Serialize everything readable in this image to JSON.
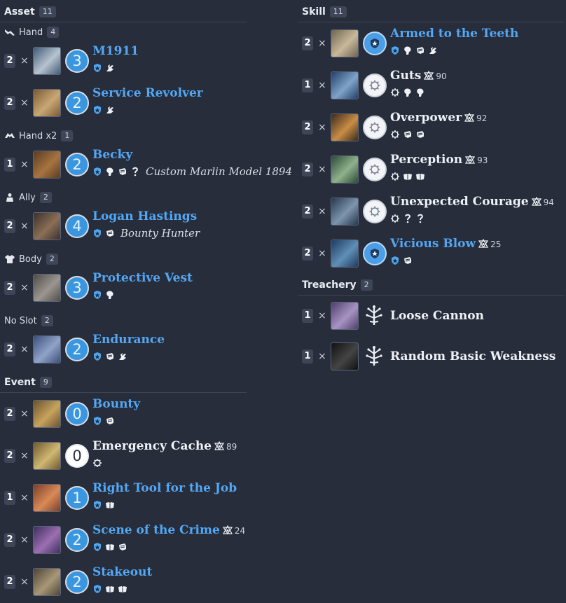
{
  "sections": {
    "asset": {
      "title": "Asset",
      "count": "11"
    },
    "event": {
      "title": "Event",
      "count": "9"
    },
    "skill": {
      "title": "Skill",
      "count": "11"
    },
    "treachery": {
      "title": "Treachery",
      "count": "2"
    }
  },
  "slots": {
    "hand": {
      "label": "Hand",
      "count": "4"
    },
    "hand2": {
      "label": "Hand x2",
      "count": "1"
    },
    "ally": {
      "label": "Ally",
      "count": "2"
    },
    "body": {
      "label": "Body",
      "count": "2"
    },
    "noslot": {
      "label": "No Slot",
      "count": "2"
    }
  },
  "times_symbol": "×",
  "assets": [
    {
      "qty": "2",
      "cost": "3",
      "name": "M1911",
      "icons": [
        "guardian-icon",
        "agility-icon"
      ]
    },
    {
      "qty": "2",
      "cost": "2",
      "name": "Service Revolver",
      "icons": [
        "guardian-icon",
        "agility-icon"
      ]
    },
    {
      "qty": "1",
      "cost": "2",
      "name": "Becky",
      "subname": "Custom Marlin Model 1894",
      "icons": [
        "guardian-icon",
        "willpower-icon",
        "combat-icon",
        "wild-icon"
      ]
    },
    {
      "qty": "2",
      "cost": "4",
      "name": "Logan Hastings",
      "subname": "Bounty Hunter",
      "icons": [
        "guardian-icon",
        "combat-icon"
      ]
    },
    {
      "qty": "2",
      "cost": "3",
      "name": "Protective Vest",
      "icons": [
        "guardian-icon",
        "willpower-icon"
      ]
    },
    {
      "qty": "2",
      "cost": "2",
      "name": "Endurance",
      "icons": [
        "guardian-icon",
        "combat-icon",
        "agility-icon"
      ]
    }
  ],
  "events": [
    {
      "qty": "2",
      "cost": "0",
      "name": "Bounty",
      "icons": [
        "guardian-icon",
        "combat-icon"
      ]
    },
    {
      "qty": "2",
      "cost": "0",
      "name": "Emergency Cache",
      "xp": "89",
      "neutral": true,
      "icons": [
        "neutral-icon"
      ]
    },
    {
      "qty": "1",
      "cost": "1",
      "name": "Right Tool for the Job",
      "icons": [
        "guardian-icon",
        "intellect-icon"
      ]
    },
    {
      "qty": "2",
      "cost": "2",
      "name": "Scene of the Crime",
      "xp": "24",
      "icons": [
        "guardian-icon",
        "intellect-icon",
        "combat-icon"
      ]
    },
    {
      "qty": "2",
      "cost": "2",
      "name": "Stakeout",
      "icons": [
        "guardian-icon",
        "intellect-icon",
        "intellect-icon"
      ]
    }
  ],
  "skills": [
    {
      "qty": "2",
      "name": "Armed to the Teeth",
      "guardian": true,
      "icons": [
        "guardian-icon",
        "willpower-icon",
        "combat-icon",
        "agility-icon"
      ]
    },
    {
      "qty": "1",
      "name": "Guts",
      "xp": "90",
      "icons": [
        "neutral-icon",
        "willpower-icon",
        "willpower-icon"
      ]
    },
    {
      "qty": "2",
      "name": "Overpower",
      "xp": "92",
      "icons": [
        "neutral-icon",
        "combat-icon",
        "combat-icon"
      ]
    },
    {
      "qty": "2",
      "name": "Perception",
      "xp": "93",
      "icons": [
        "neutral-icon",
        "intellect-icon",
        "intellect-icon"
      ]
    },
    {
      "qty": "2",
      "name": "Unexpected Courage",
      "xp": "94",
      "icons": [
        "neutral-icon",
        "wild-icon",
        "wild-icon"
      ]
    },
    {
      "qty": "2",
      "name": "Vicious Blow",
      "xp": "25",
      "guardian": true,
      "icons": [
        "guardian-icon",
        "combat-icon"
      ]
    }
  ],
  "treacheries": [
    {
      "qty": "1",
      "name": "Loose Cannon"
    },
    {
      "qty": "1",
      "name": "Random Basic Weakness"
    }
  ],
  "colors": {
    "background": "#272d3a",
    "accent_blue": "#53a7f4",
    "badge": "#3d4556",
    "text": "#e8ecf3"
  }
}
